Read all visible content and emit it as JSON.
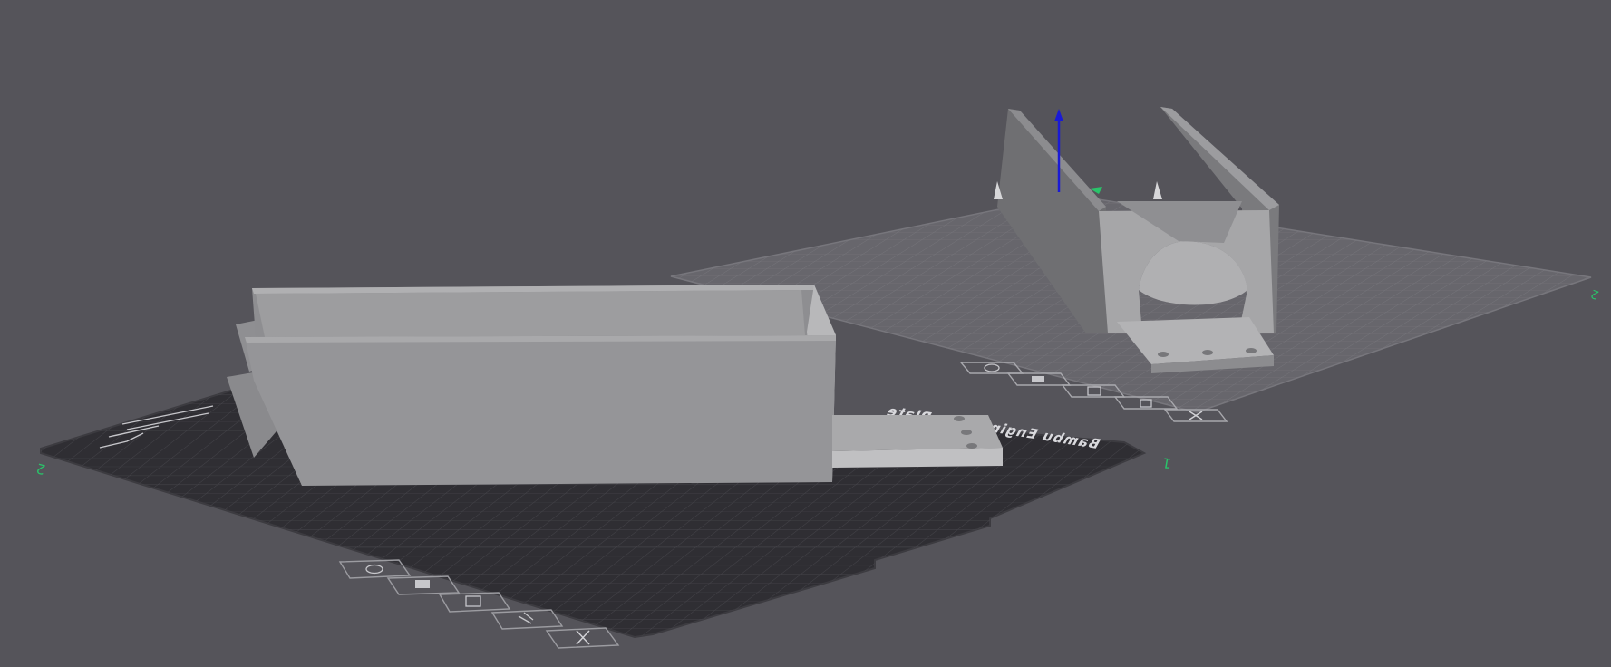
{
  "viewport": {
    "background_color": "#55545a"
  },
  "plate_1": {
    "label": "Bambu Engineering Plate",
    "index_label": "1",
    "surface_color": "#2f2e33",
    "grid_color": "#4a494f"
  },
  "plate_2": {
    "index_label": "2",
    "surface_color": "#6b6a70",
    "grid_color": "#7c7b81"
  },
  "plate_buttons": [
    {
      "icon": "arrange-icon",
      "label": "Arrange"
    },
    {
      "icon": "orient-icon",
      "label": "Auto orient"
    },
    {
      "icon": "plate-settings-icon",
      "label": "Plate settings"
    },
    {
      "icon": "lock-icon",
      "label": "Lock"
    },
    {
      "icon": "close-icon",
      "label": "Delete plate"
    }
  ],
  "models": [
    {
      "name": "box-enclosure",
      "color": "#9a9a9a"
    },
    {
      "name": "u-cradle-bracket",
      "color": "#9a9a9a"
    }
  ],
  "gizmo": {
    "z_axis_color": "#1a1ad6",
    "x_axis_color": "#29c46a"
  }
}
